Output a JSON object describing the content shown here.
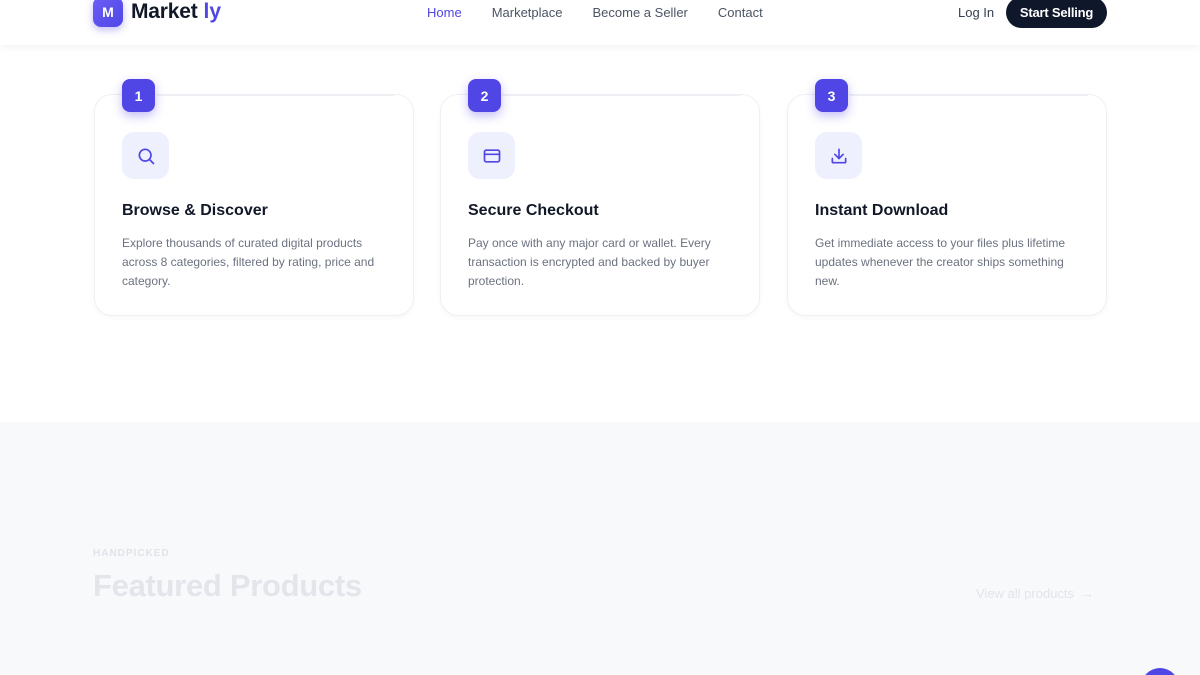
{
  "header": {
    "logo_letter": "M",
    "logo_text": "Market",
    "logo_accent": "ly",
    "nav": [
      {
        "label": "Home",
        "active": true
      },
      {
        "label": "Marketplace",
        "active": false
      },
      {
        "label": "Become a Seller",
        "active": false
      },
      {
        "label": "Contact",
        "active": false
      }
    ],
    "login_label": "Log In",
    "cta_label": "Start Selling"
  },
  "steps": [
    {
      "number": "1",
      "icon": "search-icon",
      "title": "Browse & Discover",
      "description": "Explore thousands of curated digital products across 8 categories, filtered by rating, price and category."
    },
    {
      "number": "2",
      "icon": "credit-card-icon",
      "title": "Secure Checkout",
      "description": "Pay once with any major card or wallet. Every transaction is encrypted and backed by buyer protection."
    },
    {
      "number": "3",
      "icon": "download-icon",
      "title": "Instant Download",
      "description": "Get immediate access to your files plus lifetime updates whenever the creator ships something new."
    }
  ],
  "featured": {
    "eyebrow": "HANDPICKED",
    "title": "Featured Products",
    "view_all_label": "View all products",
    "view_all_arrow": "→"
  },
  "colors": {
    "accent": "#4f46e5",
    "dark": "#0f172a",
    "muted_text": "#6b7280",
    "icon_bg": "#eef0fd"
  }
}
